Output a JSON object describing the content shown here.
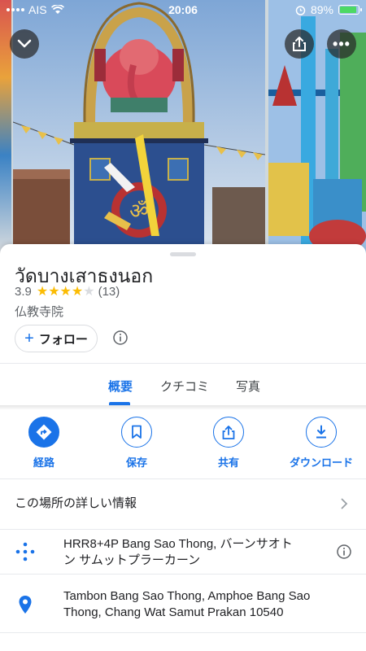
{
  "status_bar": {
    "carrier": "AIS",
    "time": "20:06",
    "battery_percent": "89%",
    "battery_level": 0.89,
    "battery_color": "#4cd964"
  },
  "overlay": {
    "collapse_icon": "chevron-down-icon",
    "share_icon": "share-icon",
    "more_icon": "more-horizontal-icon",
    "more_glyph": "•••"
  },
  "place": {
    "title": "วัดบางเสาธงนอก",
    "rating": "3.9",
    "rating_value": 3.9,
    "stars_filled": 4,
    "stars_total": 5,
    "review_count": "(13)",
    "category": "仏教寺院",
    "follow_label": "フォロー",
    "follow_plus": "+"
  },
  "tabs": [
    {
      "label": "概要",
      "active": true
    },
    {
      "label": "クチコミ",
      "active": false
    },
    {
      "label": "写真",
      "active": false
    }
  ],
  "actions": [
    {
      "label": "経路",
      "icon": "directions-icon"
    },
    {
      "label": "保存",
      "icon": "bookmark-icon"
    },
    {
      "label": "共有",
      "icon": "share-icon"
    },
    {
      "label": "ダウンロード",
      "icon": "download-icon"
    }
  ],
  "details": {
    "more_info_label": "この場所の詳しい情報",
    "plus_code": "HRR8+4P Bang Sao Thong, バーンサオトン サムットプラーカーン",
    "plus_code_line1": "HRR8+4P Bang Sao Thong, バーンサオト",
    "plus_code_line2": "ン サムットプラーカーン",
    "address_line1": "Tambon Bang Sao Thong, Amphoe Bang Sao",
    "address_line2": "Thong, Chang Wat Samut Prakan 10540"
  },
  "colors": {
    "accent": "#1a73e8",
    "star": "#fbbc04",
    "text_primary": "#202124",
    "text_secondary": "#5f6368",
    "divider": "#e8eaed"
  }
}
